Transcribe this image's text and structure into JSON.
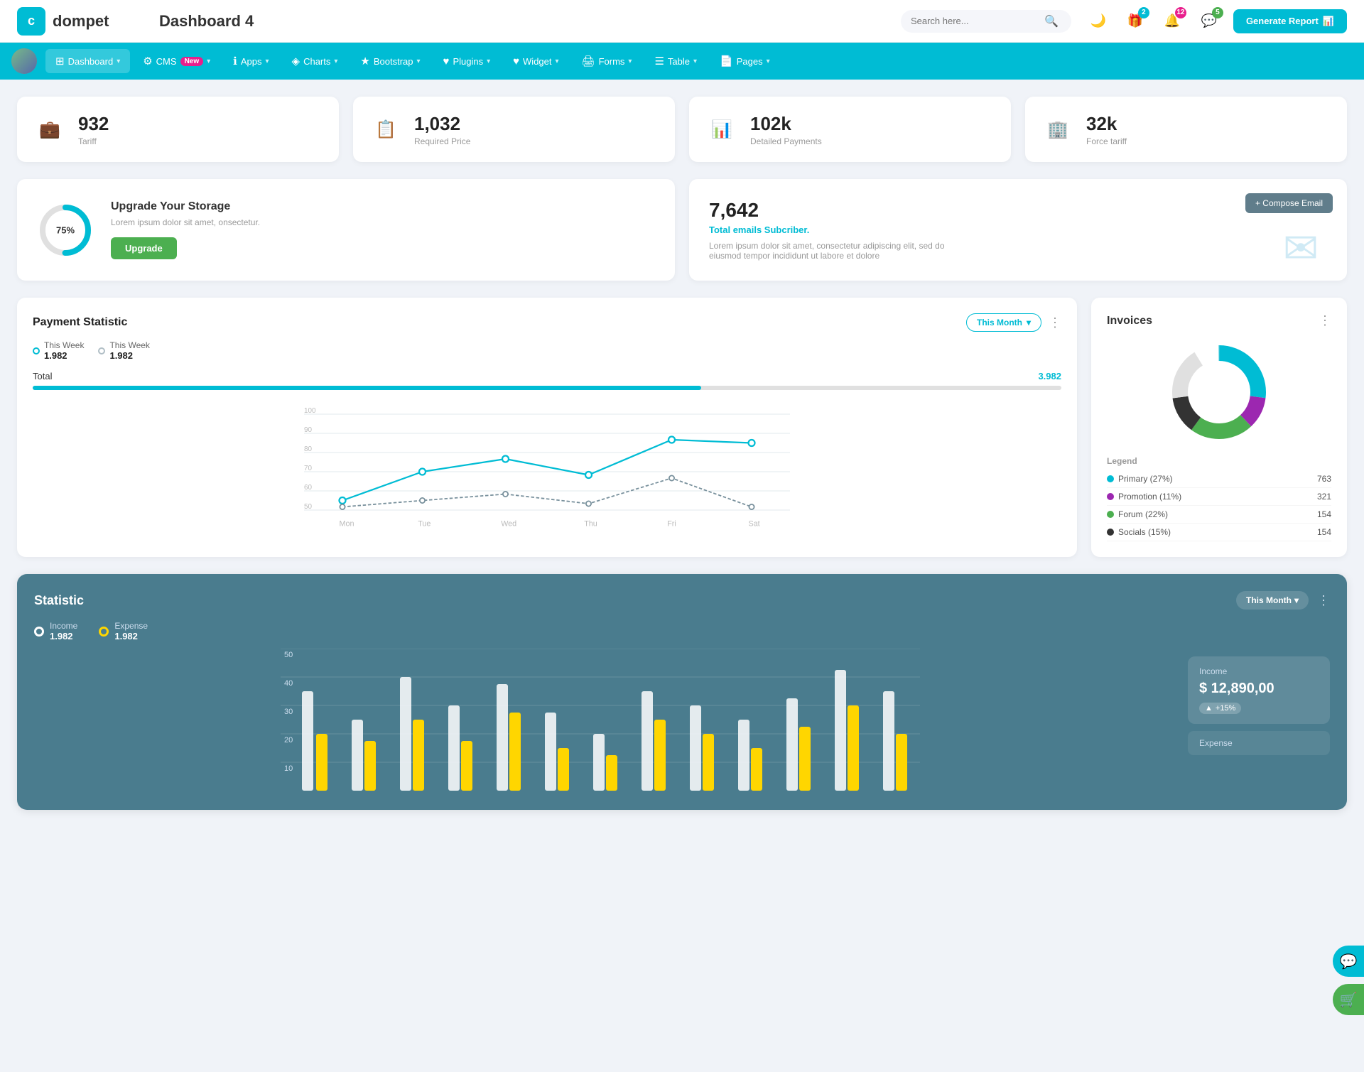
{
  "header": {
    "logo_letter": "c",
    "logo_name": "dompet",
    "page_title": "Dashboard 4",
    "search_placeholder": "Search here...",
    "generate_btn": "Generate Report",
    "icons": {
      "gift_badge": "2",
      "bell_badge": "12",
      "chat_badge": "5"
    }
  },
  "nav": {
    "items": [
      {
        "id": "dashboard",
        "label": "Dashboard",
        "icon": "⊞",
        "active": true,
        "badge": ""
      },
      {
        "id": "cms",
        "label": "CMS",
        "icon": "⚙",
        "active": false,
        "badge": "New"
      },
      {
        "id": "apps",
        "label": "Apps",
        "icon": "ℹ",
        "active": false,
        "badge": ""
      },
      {
        "id": "charts",
        "label": "Charts",
        "icon": "◈",
        "active": false,
        "badge": ""
      },
      {
        "id": "bootstrap",
        "label": "Bootstrap",
        "icon": "★",
        "active": false,
        "badge": ""
      },
      {
        "id": "plugins",
        "label": "Plugins",
        "icon": "♥",
        "active": false,
        "badge": ""
      },
      {
        "id": "widget",
        "label": "Widget",
        "icon": "♥",
        "active": false,
        "badge": ""
      },
      {
        "id": "forms",
        "label": "Forms",
        "icon": "🖨",
        "active": false,
        "badge": ""
      },
      {
        "id": "table",
        "label": "Table",
        "icon": "☰",
        "active": false,
        "badge": ""
      },
      {
        "id": "pages",
        "label": "Pages",
        "icon": "📄",
        "active": false,
        "badge": ""
      }
    ]
  },
  "stat_cards": [
    {
      "id": "tariff",
      "number": "932",
      "label": "Tariff",
      "icon": "💼",
      "color": "teal"
    },
    {
      "id": "required_price",
      "number": "1,032",
      "label": "Required Price",
      "icon": "📋",
      "color": "red"
    },
    {
      "id": "detailed_payments",
      "number": "102k",
      "label": "Detailed Payments",
      "icon": "📊",
      "color": "purple"
    },
    {
      "id": "force_tariff",
      "number": "32k",
      "label": "Force tariff",
      "icon": "🏢",
      "color": "pink"
    }
  ],
  "upgrade_card": {
    "percent": "75%",
    "title": "Upgrade Your Storage",
    "description": "Lorem ipsum dolor sit amet, onsectetur.",
    "button_label": "Upgrade"
  },
  "email_card": {
    "count": "7,642",
    "subtitle": "Total emails Subcriber.",
    "description": "Lorem ipsum dolor sit amet, consectetur adipiscing elit, sed do eiusmod tempor incididunt ut labore et dolore",
    "compose_btn": "+ Compose Email"
  },
  "payment_statistic": {
    "title": "Payment Statistic",
    "month_label": "This Month",
    "legend": [
      {
        "label": "This Week",
        "value": "1.982",
        "color": "#00bcd4"
      },
      {
        "label": "This Week",
        "value": "1.982",
        "color": "#b0bec5"
      }
    ],
    "total_label": "Total",
    "total_value": "3.982",
    "progress_percent": 65,
    "x_labels": [
      "Mon",
      "Tue",
      "Wed",
      "Thu",
      "Fri",
      "Sat"
    ],
    "line1_points": "40,160 175,140 305,110 435,130 565,85 695,80",
    "line2_points": "40,170 175,175 305,155 435,165 565,120 695,170"
  },
  "invoices": {
    "title": "Invoices",
    "donut": {
      "segments": [
        {
          "label": "Primary (27%)",
          "color": "#00bcd4",
          "value": 763,
          "percent": 27
        },
        {
          "label": "Promotion (11%)",
          "color": "#9c27b0",
          "value": 321,
          "percent": 11
        },
        {
          "label": "Forum (22%)",
          "color": "#4caf50",
          "value": 154,
          "percent": 22
        },
        {
          "label": "Socials (15%)",
          "color": "#222",
          "value": 154,
          "percent": 15
        }
      ]
    },
    "legend_title": "Legend"
  },
  "statistic": {
    "title": "Statistic",
    "month_label": "This Month",
    "y_labels": [
      "50",
      "40",
      "30",
      "20",
      "10"
    ],
    "income": {
      "label": "Income",
      "value": "1.982",
      "box_label": "Income",
      "box_value": "$ 12,890,00",
      "box_badge": "+15%"
    },
    "expense": {
      "label": "Expense",
      "value": "1.982",
      "box_label": "Expense"
    }
  },
  "float_buttons": {
    "chat_icon": "💬",
    "cart_icon": "🛒"
  }
}
